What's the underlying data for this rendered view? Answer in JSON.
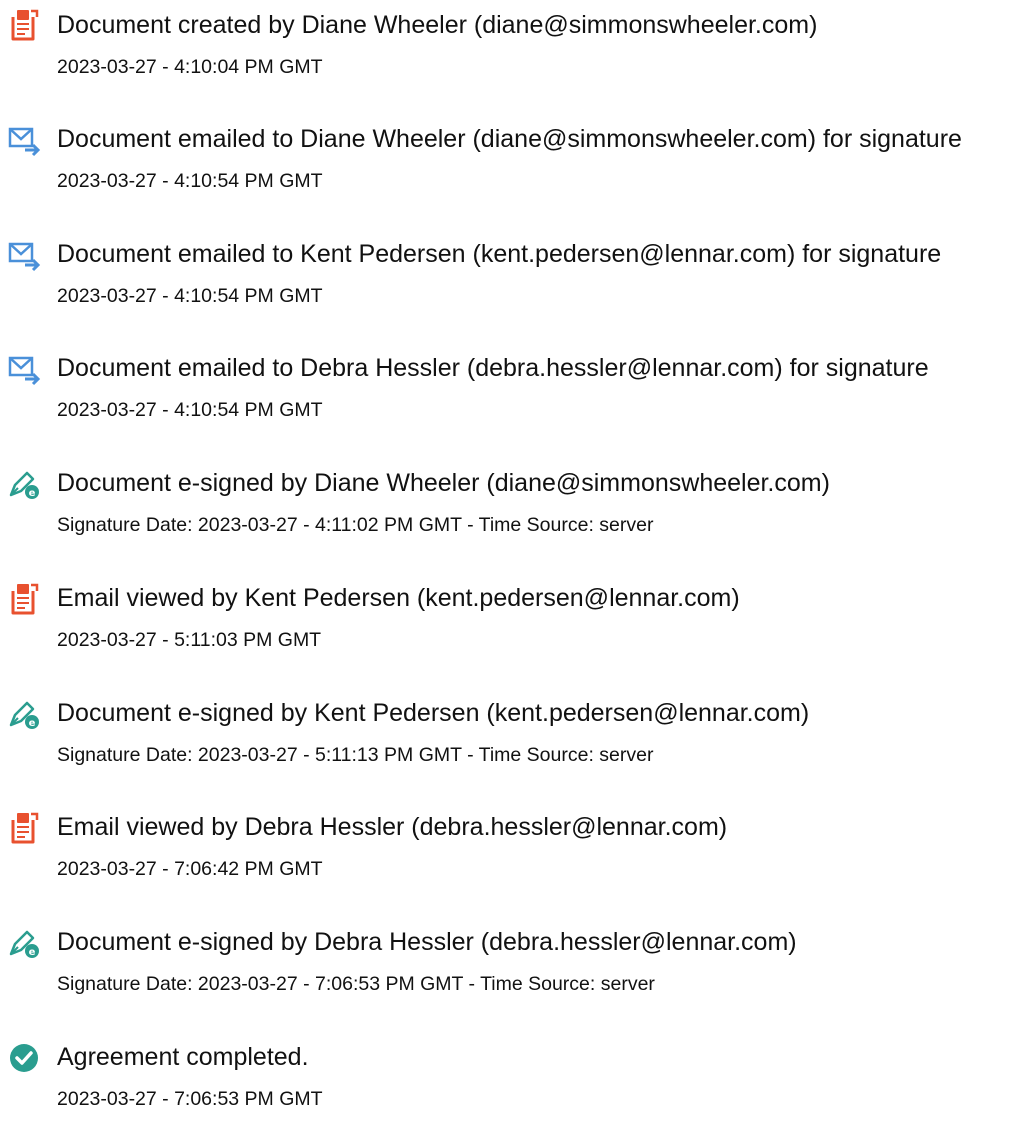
{
  "events": [
    {
      "icon": "document-created-icon",
      "text": "Document created by Diane Wheeler (diane@simmonswheeler.com)",
      "detail": "2023-03-27 - 4:10:04 PM GMT"
    },
    {
      "icon": "email-sent-icon",
      "text": "Document emailed to Diane Wheeler (diane@simmonswheeler.com) for signature",
      "detail": "2023-03-27 - 4:10:54 PM GMT"
    },
    {
      "icon": "email-sent-icon",
      "text": "Document emailed to Kent Pedersen (kent.pedersen@lennar.com) for signature",
      "detail": "2023-03-27 - 4:10:54 PM GMT"
    },
    {
      "icon": "email-sent-icon",
      "text": "Document emailed to Debra Hessler (debra.hessler@lennar.com) for signature",
      "detail": "2023-03-27 - 4:10:54 PM GMT"
    },
    {
      "icon": "e-signature-icon",
      "text": "Document e-signed by Diane Wheeler (diane@simmonswheeler.com)",
      "detail": "Signature Date: 2023-03-27 - 4:11:02 PM GMT - Time Source: server"
    },
    {
      "icon": "document-viewed-icon",
      "text": "Email viewed by Kent Pedersen (kent.pedersen@lennar.com)",
      "detail": "2023-03-27 - 5:11:03 PM GMT"
    },
    {
      "icon": "e-signature-icon",
      "text": "Document e-signed by Kent Pedersen (kent.pedersen@lennar.com)",
      "detail": "Signature Date: 2023-03-27 - 5:11:13 PM GMT - Time Source: server"
    },
    {
      "icon": "document-viewed-icon",
      "text": "Email viewed by Debra Hessler (debra.hessler@lennar.com)",
      "detail": "2023-03-27 - 7:06:42 PM GMT"
    },
    {
      "icon": "e-signature-icon",
      "text": "Document e-signed by Debra Hessler (debra.hessler@lennar.com)",
      "detail": "Signature Date: 2023-03-27 - 7:06:53 PM GMT - Time Source: server"
    },
    {
      "icon": "completed-check-icon",
      "text": "Agreement completed.",
      "detail": "2023-03-27 - 7:06:53 PM GMT"
    }
  ],
  "colors": {
    "document_icon": "#e8512f",
    "email_icon": "#4a90d9",
    "signature_icon": "#2a9d8f",
    "check_icon": "#2a9d8f",
    "text": "#111111"
  }
}
